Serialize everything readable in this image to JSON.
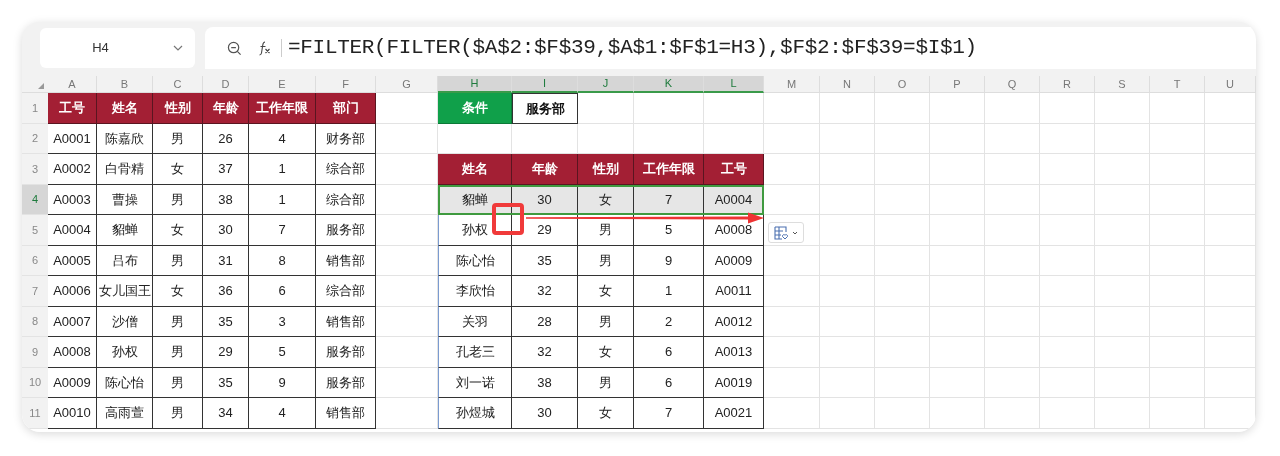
{
  "name_box": {
    "value": "H4"
  },
  "formula_bar": {
    "formula": "=FILTER(FILTER($A$2:$F$39,$A$1:$F$1=H3),$F$2:$F$39=$I$1)"
  },
  "column_headers": [
    {
      "label": "A",
      "selected": false
    },
    {
      "label": "B",
      "selected": false
    },
    {
      "label": "C",
      "selected": false
    },
    {
      "label": "D",
      "selected": false
    },
    {
      "label": "E",
      "selected": false
    },
    {
      "label": "F",
      "selected": false
    },
    {
      "label": "G",
      "selected": false
    },
    {
      "label": "H",
      "selected": true
    },
    {
      "label": "I",
      "selected": true
    },
    {
      "label": "J",
      "selected": true
    },
    {
      "label": "K",
      "selected": true
    },
    {
      "label": "L",
      "selected": true
    },
    {
      "label": "M",
      "selected": false
    },
    {
      "label": "N",
      "selected": false
    },
    {
      "label": "O",
      "selected": false
    },
    {
      "label": "P",
      "selected": false
    },
    {
      "label": "Q",
      "selected": false
    },
    {
      "label": "R",
      "selected": false
    },
    {
      "label": "S",
      "selected": false
    },
    {
      "label": "T",
      "selected": false
    },
    {
      "label": "U",
      "selected": false
    }
  ],
  "row_headers": [
    {
      "label": "1",
      "selected": false
    },
    {
      "label": "2",
      "selected": false
    },
    {
      "label": "3",
      "selected": false
    },
    {
      "label": "4",
      "selected": true
    },
    {
      "label": "5",
      "selected": false
    },
    {
      "label": "6",
      "selected": false
    },
    {
      "label": "7",
      "selected": false
    },
    {
      "label": "8",
      "selected": false
    },
    {
      "label": "9",
      "selected": false
    },
    {
      "label": "10",
      "selected": false
    },
    {
      "label": "11",
      "selected": false
    }
  ],
  "source_table": {
    "columns": [
      "工号",
      "姓名",
      "性别",
      "年龄",
      "工作年限",
      "部门"
    ],
    "rows": [
      [
        "A0001",
        "陈嘉欣",
        "男",
        "26",
        "4",
        "财务部"
      ],
      [
        "A0002",
        "白骨精",
        "女",
        "37",
        "1",
        "综合部"
      ],
      [
        "A0003",
        "曹操",
        "男",
        "38",
        "1",
        "综合部"
      ],
      [
        "A0004",
        "貂蝉",
        "女",
        "30",
        "7",
        "服务部"
      ],
      [
        "A0005",
        "吕布",
        "男",
        "31",
        "8",
        "销售部"
      ],
      [
        "A0006",
        "女儿国王",
        "女",
        "36",
        "6",
        "综合部"
      ],
      [
        "A0007",
        "沙僧",
        "男",
        "35",
        "3",
        "销售部"
      ],
      [
        "A0008",
        "孙权",
        "男",
        "29",
        "5",
        "服务部"
      ],
      [
        "A0009",
        "陈心怡",
        "男",
        "35",
        "9",
        "服务部"
      ],
      [
        "A0010",
        "高雨萱",
        "男",
        "34",
        "4",
        "销售部"
      ]
    ]
  },
  "condition": {
    "label": "条件",
    "value": "服务部"
  },
  "result_table": {
    "columns": [
      "姓名",
      "年龄",
      "性别",
      "工作年限",
      "工号"
    ],
    "rows": [
      {
        "cells": [
          "貂蝉",
          "30",
          "女",
          "7",
          "A0004"
        ],
        "selected": true
      },
      {
        "cells": [
          "孙权",
          "29",
          "男",
          "5",
          "A0008"
        ],
        "selected": false
      },
      {
        "cells": [
          "陈心怡",
          "35",
          "男",
          "9",
          "A0009"
        ],
        "selected": false
      },
      {
        "cells": [
          "李欣怡",
          "32",
          "女",
          "1",
          "A0011"
        ],
        "selected": false
      },
      {
        "cells": [
          "关羽",
          "28",
          "男",
          "2",
          "A0012"
        ],
        "selected": false
      },
      {
        "cells": [
          "孔老三",
          "32",
          "女",
          "6",
          "A0013"
        ],
        "selected": false
      },
      {
        "cells": [
          "刘一诺",
          "38",
          "男",
          "6",
          "A0019"
        ],
        "selected": false
      },
      {
        "cells": [
          "孙煜城",
          "30",
          "女",
          "7",
          "A0021"
        ],
        "selected": false
      }
    ]
  }
}
